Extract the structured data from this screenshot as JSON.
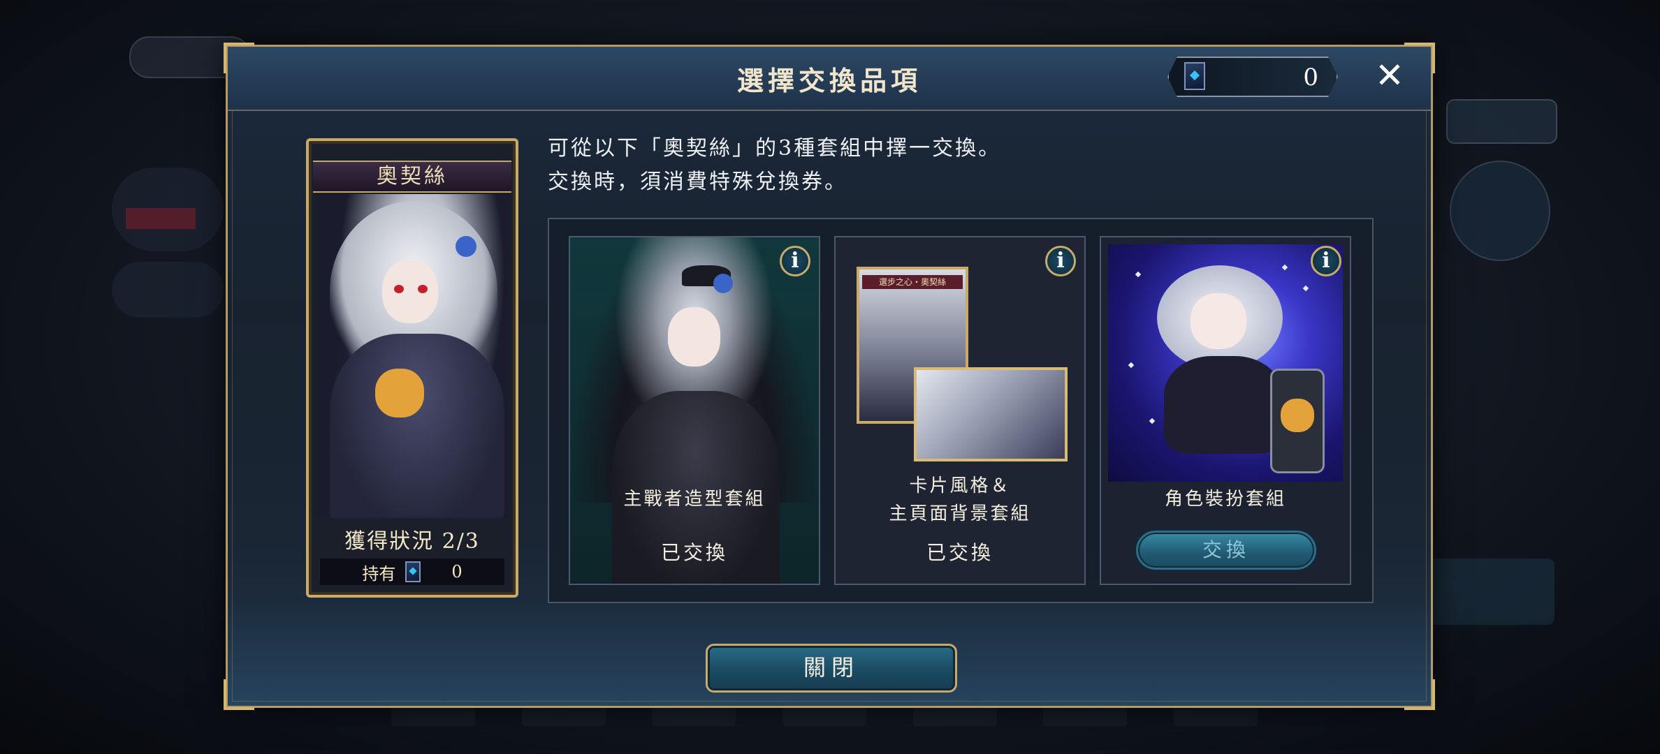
{
  "dialog": {
    "title": "選擇交換品項",
    "ticket_count": "0",
    "close_label": "✕",
    "bottom_close_label": "關閉"
  },
  "character": {
    "name": "奧契絲",
    "status": "獲得狀況 2/3",
    "own_label": "持有",
    "own_count": "0"
  },
  "description": {
    "line1": "可從以下「奧契絲」的3種套組中擇一交換。",
    "line2": "交換時，須消費特殊兌換券。"
  },
  "sets": [
    {
      "label_lines": [
        "主戰者造型套組"
      ],
      "status": "已交換",
      "info": "i"
    },
    {
      "label_lines": [
        "卡片風格＆",
        "主頁面背景套組"
      ],
      "status": "已交換",
      "info": "i",
      "mini_card_tag": "選步之心・奧契絲"
    },
    {
      "label_lines": [
        "角色裝扮套組"
      ],
      "button": "交換",
      "info": "i"
    }
  ],
  "colors": {
    "gold_border": "#c9aa6a",
    "header": "#2d4864",
    "button_teal": "#2a6c86"
  },
  "icons": [
    "ticket-icon",
    "close-icon",
    "info-icon"
  ]
}
